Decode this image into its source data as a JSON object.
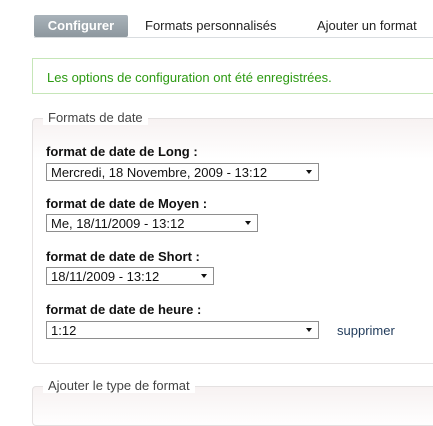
{
  "tabs": [
    {
      "label": "Configurer",
      "active": true
    },
    {
      "label": "Formats personnalisés"
    },
    {
      "label": "Ajouter un format"
    }
  ],
  "status_message": "Les options de configuration ont été enregistrées.",
  "date_formats": {
    "legend": "Formats de date",
    "fields": [
      {
        "label": "format de date de Long :",
        "value": "Mercredi, 18 Novembre, 2009 - 13:12"
      },
      {
        "label": "format de date de Moyen :",
        "value": "Me, 18/11/2009 - 13:12"
      },
      {
        "label": "format de date de Short :",
        "value": "18/11/2009 - 13:12"
      },
      {
        "label": "format de date de heure :",
        "value": "1:12",
        "action": "supprimer"
      }
    ]
  },
  "add_format_type": {
    "legend": "Ajouter le type de format"
  },
  "colors": {
    "status_text": "#2c9a12",
    "status_border": "#c6e6b8",
    "tab_active_bg": "#98a2a9"
  }
}
